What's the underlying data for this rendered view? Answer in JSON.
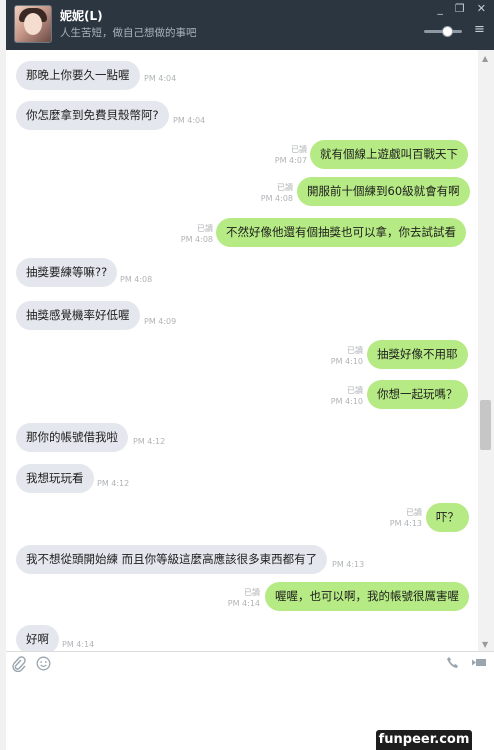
{
  "header": {
    "name": "妮妮(L)",
    "status": "人生苦短，做自己想做的事吧",
    "buttons": [
      "_",
      "❐",
      "✕"
    ]
  },
  "messages": [
    {
      "dir": "in",
      "text": "那晚上你要久一點喔",
      "time": "PM 4:04"
    },
    {
      "dir": "in",
      "text": "你怎麼拿到免費貝殼幣阿?",
      "time": "PM 4:04"
    },
    {
      "dir": "out",
      "text": "就有個線上遊戲叫百戰天下",
      "read": "已讀",
      "time": "PM 4:07"
    },
    {
      "dir": "out",
      "text": "開服前十個練到60級就會有啊",
      "read": "已讀",
      "time": "PM 4:08"
    },
    {
      "dir": "out",
      "text": "不然好像他還有個抽獎也可以拿，你去試試看",
      "read": "已讀",
      "time": "PM 4:08"
    },
    {
      "dir": "in",
      "text": "抽獎要練等嘛??",
      "time": "PM 4:08"
    },
    {
      "dir": "in",
      "text": "抽獎感覺機率好低喔",
      "time": "PM 4:09"
    },
    {
      "dir": "out",
      "text": "抽獎好像不用耶",
      "read": "已讀",
      "time": "PM 4:10"
    },
    {
      "dir": "out",
      "text": "你想一起玩嗎？",
      "read": "已讀",
      "time": "PM 4:10"
    },
    {
      "dir": "in",
      "text": "那你的帳號借我啦",
      "time": "PM 4:12"
    },
    {
      "dir": "in",
      "text": "我想玩玩看",
      "time": "PM 4:12"
    },
    {
      "dir": "out",
      "text": "吓？",
      "read": "已讀",
      "time": "PM 4:13"
    },
    {
      "dir": "in",
      "text": "我不想從頭開始練 而且你等級這麼高應該很多東西都有了",
      "time": "PM 4:13"
    },
    {
      "dir": "out",
      "text": "喔喔，也可以啊，我的帳號很厲害喔",
      "read": "已讀",
      "time": "PM 4:14"
    },
    {
      "dir": "in",
      "text": "好啊",
      "time": "PM 4:14"
    }
  ],
  "toolbar": {
    "attach_icon": "paperclip-icon",
    "emoji_icon": "smiley-icon",
    "call_icon": "phone-icon",
    "video_icon": "video-icon"
  },
  "watermark": "funpeer.com",
  "colors": {
    "header_bg": "#2c3640",
    "incoming_bubble": "#e4e8ee",
    "outgoing_bubble": "#b6ea84"
  }
}
